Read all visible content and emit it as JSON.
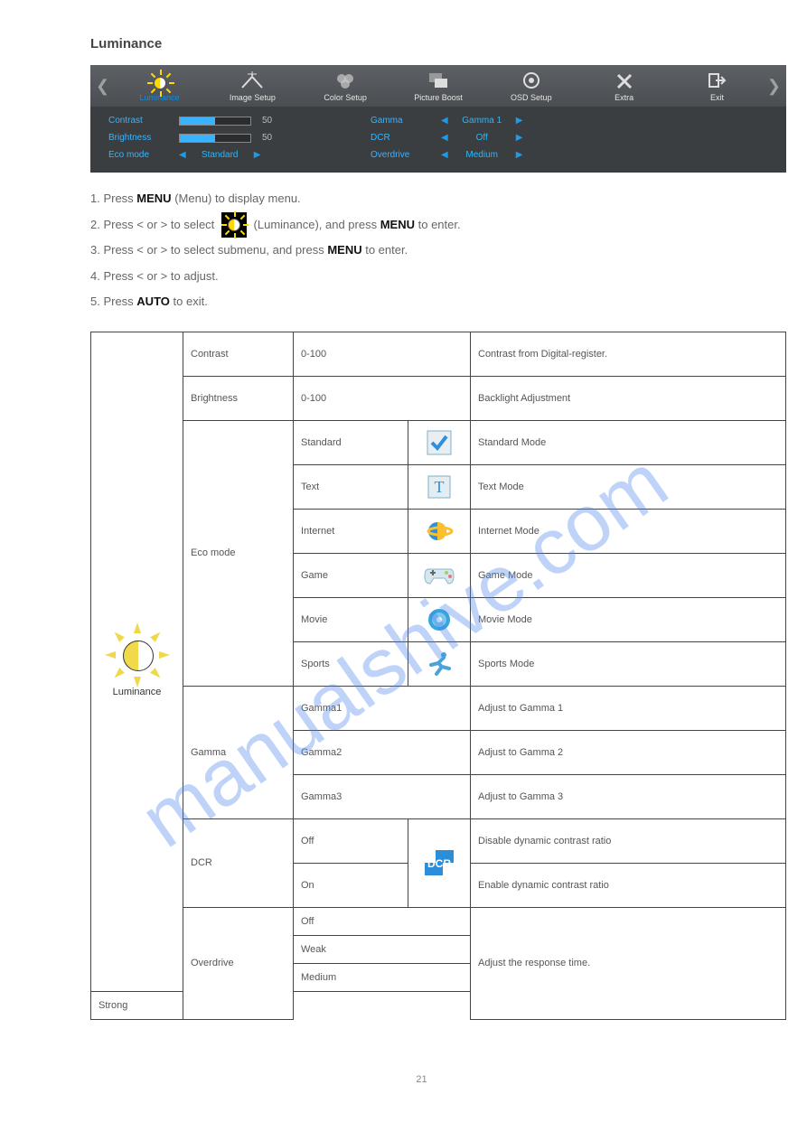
{
  "section_title": "Luminance",
  "osd": {
    "tabs": [
      {
        "label": "Luminance",
        "active": true
      },
      {
        "label": "Image Setup"
      },
      {
        "label": "Color Setup"
      },
      {
        "label": "Picture Boost"
      },
      {
        "label": "OSD Setup"
      },
      {
        "label": "Extra"
      },
      {
        "label": "Exit"
      }
    ],
    "left": [
      {
        "label": "Contrast",
        "value": "50",
        "slider": 50
      },
      {
        "label": "Brightness",
        "value": "50",
        "slider": 50
      },
      {
        "label": "Eco mode",
        "select": "Standard"
      }
    ],
    "right": [
      {
        "label": "Gamma",
        "select": "Gamma 1"
      },
      {
        "label": "DCR",
        "select": "Off"
      },
      {
        "label": "Overdrive",
        "select": "Medium"
      }
    ]
  },
  "instructions": {
    "line1a": "1. Press ",
    "menu1": "MENU",
    "line1b": " (Menu) to display menu.",
    "line2a": "2. Press < or > to select ",
    "line2b": " (Luminance), and press ",
    "menu2": "MENU",
    "line2c": " to enter.",
    "line3a": "3. Press < or > to select submenu, and press ",
    "menu3": "MENU",
    "line3b": " to enter.",
    "line4": "4. Press < or > to adjust.",
    "line5a": "5. Press ",
    "auto": "AUTO",
    "line5b": " to exit."
  },
  "table": {
    "category": "Luminance",
    "rows": [
      {
        "setting": "Contrast",
        "range": "0-100",
        "desc": "Contrast from Digital-register."
      },
      {
        "setting": "Brightness",
        "range": "0-100",
        "desc": "Backlight Adjustment"
      },
      {
        "setting": "Eco mode",
        "options": [
          {
            "name": "Standard",
            "icon": "check",
            "desc": "Standard Mode"
          },
          {
            "name": "Text",
            "icon": "text",
            "desc": "Text Mode"
          },
          {
            "name": "Internet",
            "icon": "ie",
            "desc": "Internet Mode"
          },
          {
            "name": "Game",
            "icon": "gamepad",
            "desc": "Game Mode"
          },
          {
            "name": "Movie",
            "icon": "disc",
            "desc": "Movie Mode"
          },
          {
            "name": "Sports",
            "icon": "runner",
            "desc": "Sports Mode"
          }
        ]
      },
      {
        "setting": "Gamma",
        "options": [
          {
            "name": "Gamma1",
            "desc": "Adjust to Gamma 1"
          },
          {
            "name": "Gamma2",
            "desc": "Adjust to Gamma 2"
          },
          {
            "name": "Gamma3",
            "desc": "Adjust to Gamma 3"
          }
        ]
      },
      {
        "setting": "DCR",
        "options": [
          {
            "name": "Off",
            "icon": "dcr",
            "desc": "Disable dynamic contrast ratio"
          },
          {
            "name": "On",
            "desc": "Enable dynamic contrast ratio"
          }
        ]
      },
      {
        "setting": "Overdrive",
        "options": [
          {
            "name": "Off"
          },
          {
            "name": "Weak"
          },
          {
            "name": "Medium"
          },
          {
            "name": "Strong"
          }
        ],
        "desc": "Adjust the response time."
      }
    ]
  },
  "watermark": "manualshive.com",
  "page_number": "21"
}
